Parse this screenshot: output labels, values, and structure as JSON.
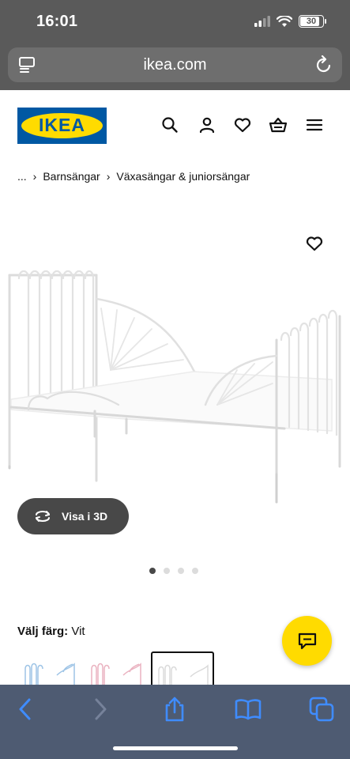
{
  "status_bar": {
    "time": "16:01",
    "battery_level": "30"
  },
  "browser": {
    "url": "ikea.com"
  },
  "header": {
    "logo_text": "IKEA",
    "icons": [
      "search-icon",
      "user-icon",
      "heart-icon",
      "basket-icon",
      "menu-icon"
    ]
  },
  "breadcrumb": {
    "ellipsis": "...",
    "items": [
      "Barnsängar",
      "Växasängar & juniorsängar"
    ]
  },
  "product": {
    "view_3d_label": "Visa i 3D",
    "carousel": {
      "count": 4,
      "active_index": 0
    },
    "color": {
      "label": "Välj färg:",
      "value": "Vit"
    }
  },
  "colors": {
    "brand_blue": "#0058a3",
    "brand_yellow": "#ffdb00",
    "toolbar_bg": "#4e5b72",
    "toolbar_icon": "#3f8cff"
  }
}
